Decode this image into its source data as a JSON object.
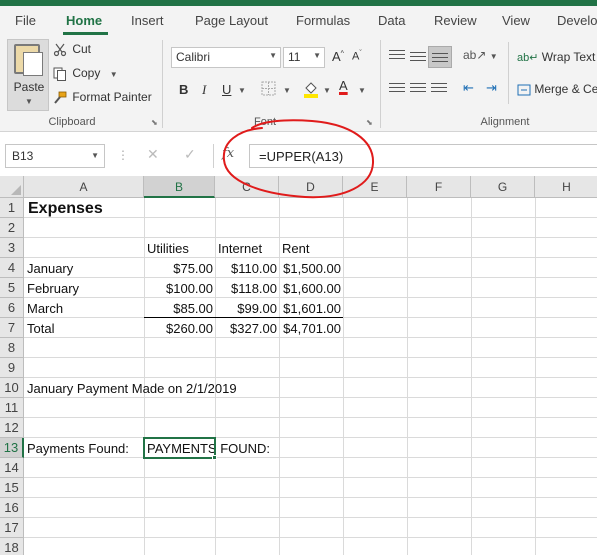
{
  "tabs": [
    "File",
    "Home",
    "Insert",
    "Page Layout",
    "Formulas",
    "Data",
    "Review",
    "View",
    "Develo"
  ],
  "active_tab": "Home",
  "ribbon": {
    "clipboard": {
      "paste": "Paste",
      "cut": "Cut",
      "copy": "Copy",
      "format_painter": "Format Painter",
      "group_label": "Clipboard"
    },
    "font": {
      "font_name": "Calibri",
      "font_size": "11",
      "bold": "B",
      "italic": "I",
      "underline": "U",
      "group_label": "Font"
    },
    "alignment": {
      "wrap_text": "Wrap Text",
      "merge_center": "Merge & Ce",
      "group_label": "Alignment"
    }
  },
  "formula_bar": {
    "name_box": "B13",
    "formula": "=UPPER(A13)",
    "fx": "fx"
  },
  "columns": [
    "A",
    "B",
    "C",
    "D",
    "E",
    "F",
    "G",
    "H"
  ],
  "selected_column": "B",
  "rows": [
    "1",
    "2",
    "3",
    "4",
    "5",
    "6",
    "7",
    "8",
    "9",
    "10",
    "11",
    "12",
    "13",
    "14",
    "15",
    "16",
    "17",
    "18"
  ],
  "selected_row": "13",
  "cells": {
    "A1": "Expenses",
    "B3": "Utilities",
    "C3": "Internet",
    "D3": "Rent",
    "A4": "January",
    "B4": "$75.00",
    "C4": "$110.00",
    "D4": "$1,500.00",
    "A5": "February",
    "B5": "$100.00",
    "C5": "$118.00",
    "D5": "$1,600.00",
    "A6": "March",
    "B6": "$85.00",
    "C6": "$99.00",
    "D6": "$1,601.00",
    "A7": "Total",
    "B7": "$260.00",
    "C7": "$327.00",
    "D7": "$4,701.00",
    "A10": "January Payment Made on 2/1/2019",
    "A13": "Payments Found:",
    "B13": "PAYMENTS FOUND:"
  },
  "colors": {
    "accent": "#217346",
    "annotation": "#e01b1b"
  }
}
